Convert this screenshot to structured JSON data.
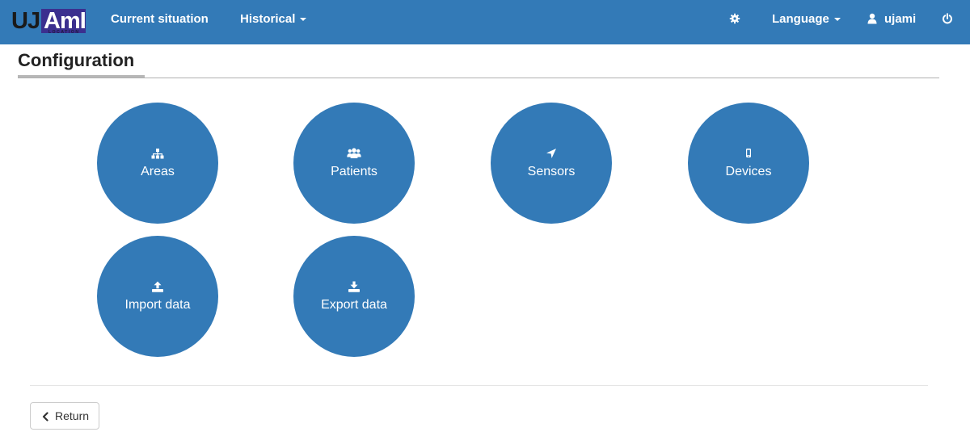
{
  "brand": {
    "logo_text_dark": "UJ",
    "logo_text_light": "AmI",
    "logo_subtext": "LOCATION"
  },
  "nav": {
    "current_situation": "Current situation",
    "historical": "Historical",
    "settings_icon": "gear-icon",
    "language": "Language",
    "user_icon": "user-icon",
    "username": "ujami",
    "logout_icon": "power-icon"
  },
  "page": {
    "title": "Configuration"
  },
  "tiles": [
    {
      "label": "Areas",
      "icon": "sitemap-icon"
    },
    {
      "label": "Patients",
      "icon": "users-icon"
    },
    {
      "label": "Sensors",
      "icon": "location-arrow-icon"
    },
    {
      "label": "Devices",
      "icon": "mobile-icon"
    },
    {
      "label": "Import data",
      "icon": "upload-icon"
    },
    {
      "label": "Export data",
      "icon": "download-icon"
    }
  ],
  "footer": {
    "return_label": "Return",
    "return_icon": "chevron-left-icon"
  },
  "colors": {
    "primary": "#337ab7",
    "title_underline": "#b7b7b7"
  }
}
